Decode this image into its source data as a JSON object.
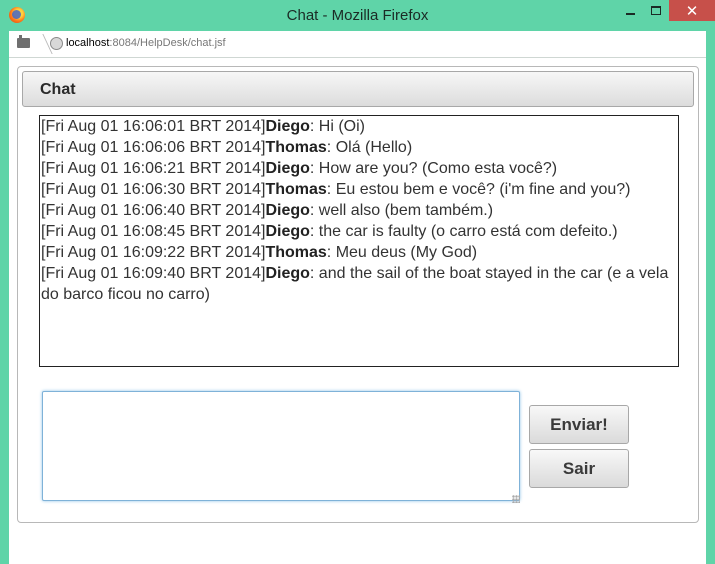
{
  "window": {
    "title": "Chat - Mozilla Firefox",
    "close_glyph": "✕"
  },
  "urlbar": {
    "host": "localhost",
    "rest": ":8084/HelpDesk/chat.jsf"
  },
  "panel": {
    "title": "Chat"
  },
  "messages": [
    {
      "ts": "[Fri Aug 01 16:06:01 BRT 2014]",
      "user": "Diego",
      "text": ": Hi (Oi)"
    },
    {
      "ts": "[Fri Aug 01 16:06:06 BRT 2014]",
      "user": "Thomas",
      "text": ": Olá (Hello)"
    },
    {
      "ts": "[Fri Aug 01 16:06:21 BRT 2014]",
      "user": "Diego",
      "text": ": How are you? (Como esta você?)"
    },
    {
      "ts": "[Fri Aug 01 16:06:30 BRT 2014]",
      "user": "Thomas",
      "text": ": Eu estou bem e você? (i'm fine and you?)"
    },
    {
      "ts": "[Fri Aug 01 16:06:40 BRT 2014]",
      "user": "Diego",
      "text": ": well also (bem também.)"
    },
    {
      "ts": "[Fri Aug 01 16:08:45 BRT 2014]",
      "user": "Diego",
      "text": ": the car is faulty (o carro está com defeito.)"
    },
    {
      "ts": "[Fri Aug 01 16:09:22 BRT 2014]",
      "user": "Thomas",
      "text": ": Meu deus (My God)"
    },
    {
      "ts": "[Fri Aug 01 16:09:40 BRT 2014]",
      "user": "Diego",
      "text": ": and the sail of the boat stayed in the car (e a vela do barco ficou no carro)"
    }
  ],
  "input": {
    "value": ""
  },
  "buttons": {
    "send_label": "Enviar!",
    "leave_label": "Sair"
  }
}
